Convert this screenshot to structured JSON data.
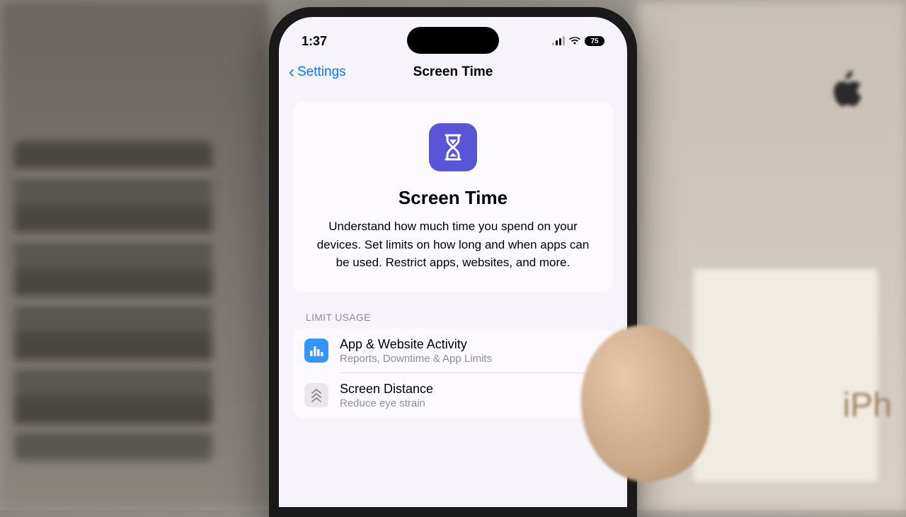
{
  "status": {
    "time": "1:37",
    "battery": "75"
  },
  "nav": {
    "back_label": "Settings",
    "title": "Screen Time"
  },
  "hero": {
    "title": "Screen Time",
    "description": "Understand how much time you spend on your devices. Set limits on how long and when apps can be used. Restrict apps, websites, and more."
  },
  "section": {
    "header": "LIMIT USAGE",
    "items": [
      {
        "title": "App & Website Activity",
        "subtitle": "Reports, Downtime & App Limits"
      },
      {
        "title": "Screen Distance",
        "subtitle": "Reduce eye strain"
      }
    ]
  },
  "bg": {
    "box_text": "iPh"
  }
}
